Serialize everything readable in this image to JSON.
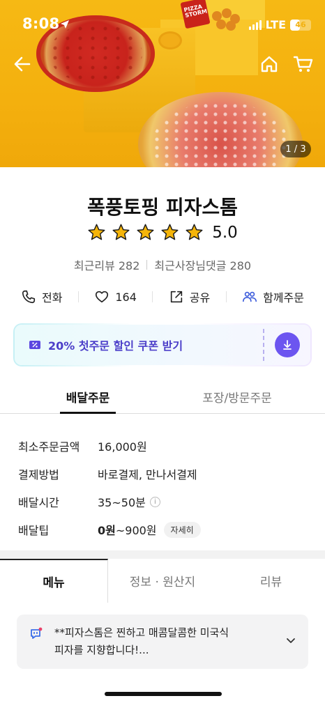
{
  "status_bar": {
    "time": "8:08",
    "network": "LTE",
    "battery": "46"
  },
  "hero": {
    "page_counter": "1 / 3",
    "box_label": "PIZZA STORM"
  },
  "store": {
    "name": "폭풍토핑 피자스톰",
    "rating": "5.0",
    "rating_stars": 5,
    "recent_reviews": "최근리뷰 282",
    "owner_replies": "최근사장님댓글 280"
  },
  "actions": [
    {
      "label": "전화",
      "icon": "phone-icon"
    },
    {
      "label": "164",
      "icon": "heart-icon"
    },
    {
      "label": "공유",
      "icon": "share-icon"
    },
    {
      "label": "함께주문",
      "icon": "group-icon"
    }
  ],
  "coupon": {
    "label": "20% 첫주문 할인 쿠폰 받기",
    "accent": "#6c55f0"
  },
  "order_tabs": [
    "배달주문",
    "포장/방문주문"
  ],
  "order_info": {
    "min_order_label": "최소주문금액",
    "min_order_value": "16,000원",
    "payment_label": "결제방법",
    "payment_value": "바로결제, 만나서결제",
    "delivery_time_label": "배달시간",
    "delivery_time_value": "35~50분",
    "tip_label": "배달팁",
    "tip_min": "0원",
    "tip_max": "~900원",
    "tip_detail": "자세히"
  },
  "menu_tabs": [
    "메뉴",
    "정보 · 원산지",
    "리뷰"
  ],
  "notice": {
    "line1": "**피자스톰은 찐하고 매콤달콤한 미국식",
    "line2": "피자를 지향합니다!..."
  },
  "colors": {
    "hero_bg": "#f6b914",
    "star": "#f5b50a",
    "coupon_text": "#4b3ec9"
  }
}
